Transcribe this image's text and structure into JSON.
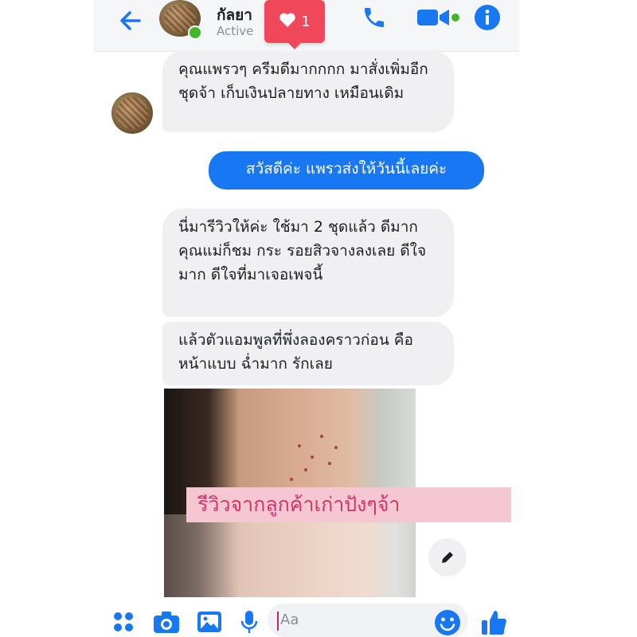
{
  "header": {
    "contact_name": "กัลยา",
    "status": "Active",
    "like_count": "1",
    "icons": [
      "back-arrow-icon",
      "phone-icon",
      "video-camera-icon",
      "info-icon"
    ],
    "accent_color": "#1877f2"
  },
  "messages": [
    {
      "direction": "incoming",
      "text": "คุณแพรวๆ ครีมดีมากกกก มาสั่งเพิ่มอีกชุดจ้า เก็บเงินปลายทาง เหมือนเดิม"
    },
    {
      "direction": "outgoing",
      "text": "สวัสดีค่ะ แพรวส่งให้วันนี้เลยค่ะ"
    },
    {
      "direction": "incoming",
      "text": "นี่มารีวิวให้ค่ะ ใช้มา 2 ชุดแล้ว ดีมาก คุณแม่ก็ชม กระ รอยสิวจางลงเลย ดีใจมาก ดีใจที่มาเจอเพจนี้"
    },
    {
      "direction": "incoming",
      "text": "แล้วตัวแอมพูลที่พึ่งลองคราวก่อน คือหน้าแบบ ฉ่ำมาก รักเลย"
    }
  ],
  "photo": {
    "caption": "รีวิวจากลูกค้าเก่าปังๆจ้า",
    "caption_color": "#d6326e"
  },
  "composer": {
    "placeholder": "Aa",
    "icons": [
      "apps-grid-icon",
      "camera-icon",
      "gallery-icon",
      "microphone-icon",
      "emoji-icon",
      "thumbs-up-icon"
    ]
  }
}
